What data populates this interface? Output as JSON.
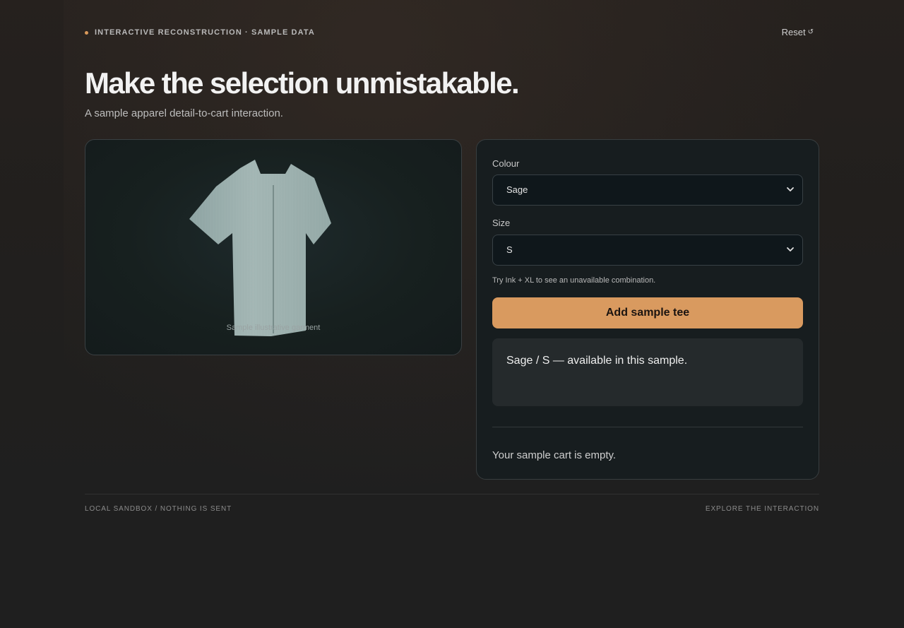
{
  "header": {
    "eyebrow": "INTERACTIVE RECONSTRUCTION · SAMPLE DATA",
    "reset_label": "Reset",
    "reset_icon": "↺",
    "title": "Make the selection unmistakable.",
    "subtitle": "A sample apparel detail-to-cart interaction."
  },
  "product": {
    "caption": "Sample illustrative garment",
    "garment_color": "#9fb2b0"
  },
  "options": {
    "colour_label": "Colour",
    "colour_value": "Sage",
    "size_label": "Size",
    "size_value": "S",
    "hint": "Try Ink + XL to see an unavailable combination.",
    "add_button": "Add sample tee",
    "status": "Sage / S — available in this sample.",
    "cart_empty": "Your sample cart is empty."
  },
  "footer": {
    "left": "LOCAL SANDBOX / NOTHING IS SENT",
    "right": "EXPLORE THE INTERACTION"
  },
  "colors": {
    "accent": "#d99a5f",
    "background": "#1f1f1f",
    "panel": "#171d1f"
  }
}
